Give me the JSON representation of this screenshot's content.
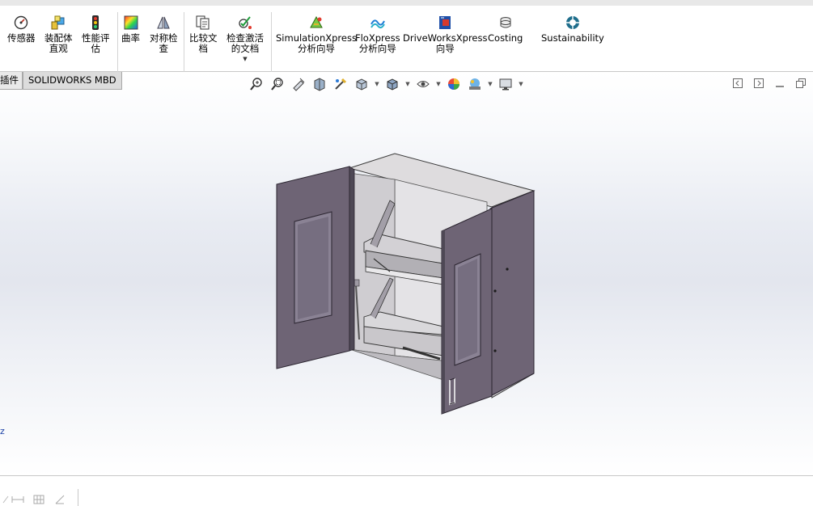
{
  "ribbon": {
    "buttons": [
      {
        "id": "sensor",
        "label": "传感器",
        "icon": "sensor-icon"
      },
      {
        "id": "assembly-visualization",
        "label": "装配体\n直观",
        "icon": "assembly-visualization-icon"
      },
      {
        "id": "performance-evaluation",
        "label": "性能评\n估",
        "icon": "performance-evaluation-icon"
      },
      {
        "id": "curvature",
        "label": "曲率",
        "icon": "curvature-icon"
      },
      {
        "id": "symmetry-check",
        "label": "对称检\n查",
        "icon": "symmetry-check-icon"
      },
      {
        "id": "compare-documents",
        "label": "比较文\n档",
        "icon": "compare-documents-icon"
      },
      {
        "id": "check-active-document",
        "label": "检查激活\n的文档",
        "icon": "check-active-document-icon"
      },
      {
        "id": "simulationxpress",
        "label": "SimulationXpress\n分析向导",
        "icon": "simulationxpress-icon"
      },
      {
        "id": "floxpress",
        "label": "FloXpress\n分析向导",
        "icon": "floxpress-icon"
      },
      {
        "id": "driveworksxpress",
        "label": "DriveWorksXpress\n向导",
        "icon": "driveworksxpress-icon"
      },
      {
        "id": "costing",
        "label": "Costing",
        "icon": "costing-icon"
      },
      {
        "id": "sustainability",
        "label": "Sustainability",
        "icon": "sustainability-icon"
      }
    ]
  },
  "tabs": [
    {
      "label": "插件"
    },
    {
      "label": "SOLIDWORKS MBD"
    }
  ],
  "heads_up_toolbar": [
    "zoom-to-fit-icon",
    "zoom-to-area-icon",
    "previous-view-icon",
    "section-view-icon",
    "dynamic-annotation-view-icon",
    "view-orientation-icon",
    "display-style-icon",
    "hide-show-items-icon",
    "edit-appearance-icon",
    "apply-scene-icon",
    "view-settings-icon"
  ],
  "viewport": {
    "side_mark": "z",
    "model_name": ""
  },
  "colors": {
    "door_panel": "#6e6475",
    "door_panel_dark": "#5a5262",
    "cabinet_body": "#c9c7c9",
    "cabinet_top": "#dedcde",
    "accent_blue": "#1a3fa6"
  }
}
